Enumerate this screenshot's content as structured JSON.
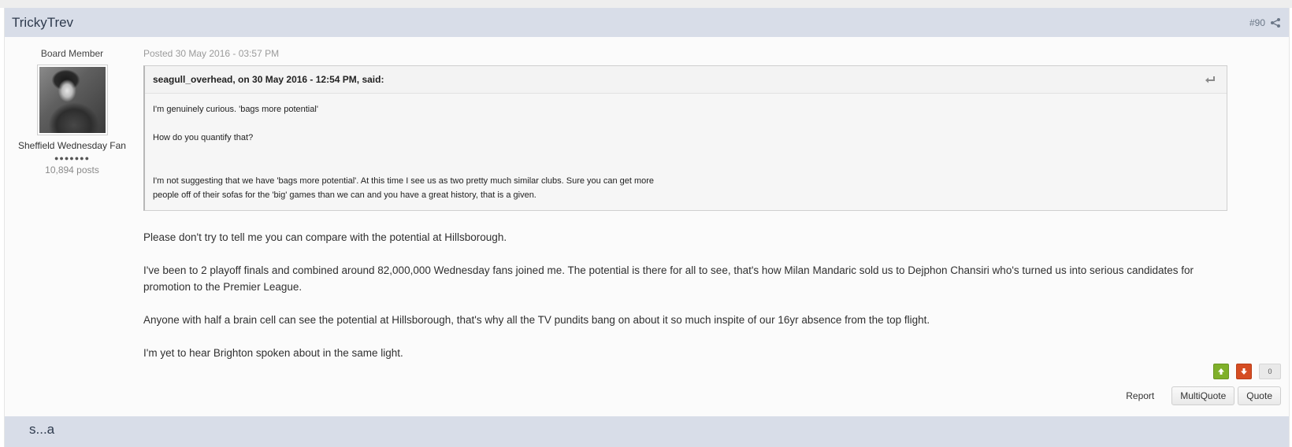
{
  "post": {
    "author": "TrickyTrev",
    "post_number": "#90",
    "member_title": "Board Member",
    "group": "Sheffield Wednesday Fan",
    "pips": "●●●●●●●",
    "post_count": "10,894 posts",
    "posted": "Posted 30 May 2016 - 03:57 PM",
    "quote": {
      "citation": "seagull_overhead, on 30 May 2016 - 12:54 PM, said:",
      "lines": [
        "I'm genuinely curious. 'bags more potential'",
        "How do you quantify that?",
        "I'm not suggesting that we have 'bags more potential'. At this time I see us as two pretty much similar clubs. Sure you can get more",
        "people off of their sofas for the 'big' games than we can and you have a great history, that is a given."
      ]
    },
    "paragraphs": [
      "Please don't try to tell me you can compare with the potential at Hillsborough.",
      "I've been to 2 playoff finals and combined around 82,000,000 Wednesday fans joined me. The potential is there for all to see, that's how Milan Mandaric sold us to Dejphon Chansiri who's turned us into serious candidates for promotion to the Premier League.",
      "Anyone with half a brain cell can see the potential at Hillsborough, that's why all the TV pundits bang on about it so much inspite of our 16yr absence from the top flight.",
      "I'm yet to hear Brighton spoken about in the same light."
    ],
    "reputation": "0",
    "actions": {
      "report": "Report",
      "multiquote": "MultiQuote",
      "quote": "Quote"
    }
  },
  "next_post": {
    "author": "s...a"
  },
  "icons": {
    "share": "share-icon",
    "snapback": "snapback-icon",
    "rep_up": "thumbs-up-arrow-icon",
    "rep_down": "thumbs-down-arrow-icon"
  },
  "colors": {
    "header_bg": "#d8dde8",
    "rep_up": "#7fb02a",
    "rep_down": "#d54c22"
  }
}
